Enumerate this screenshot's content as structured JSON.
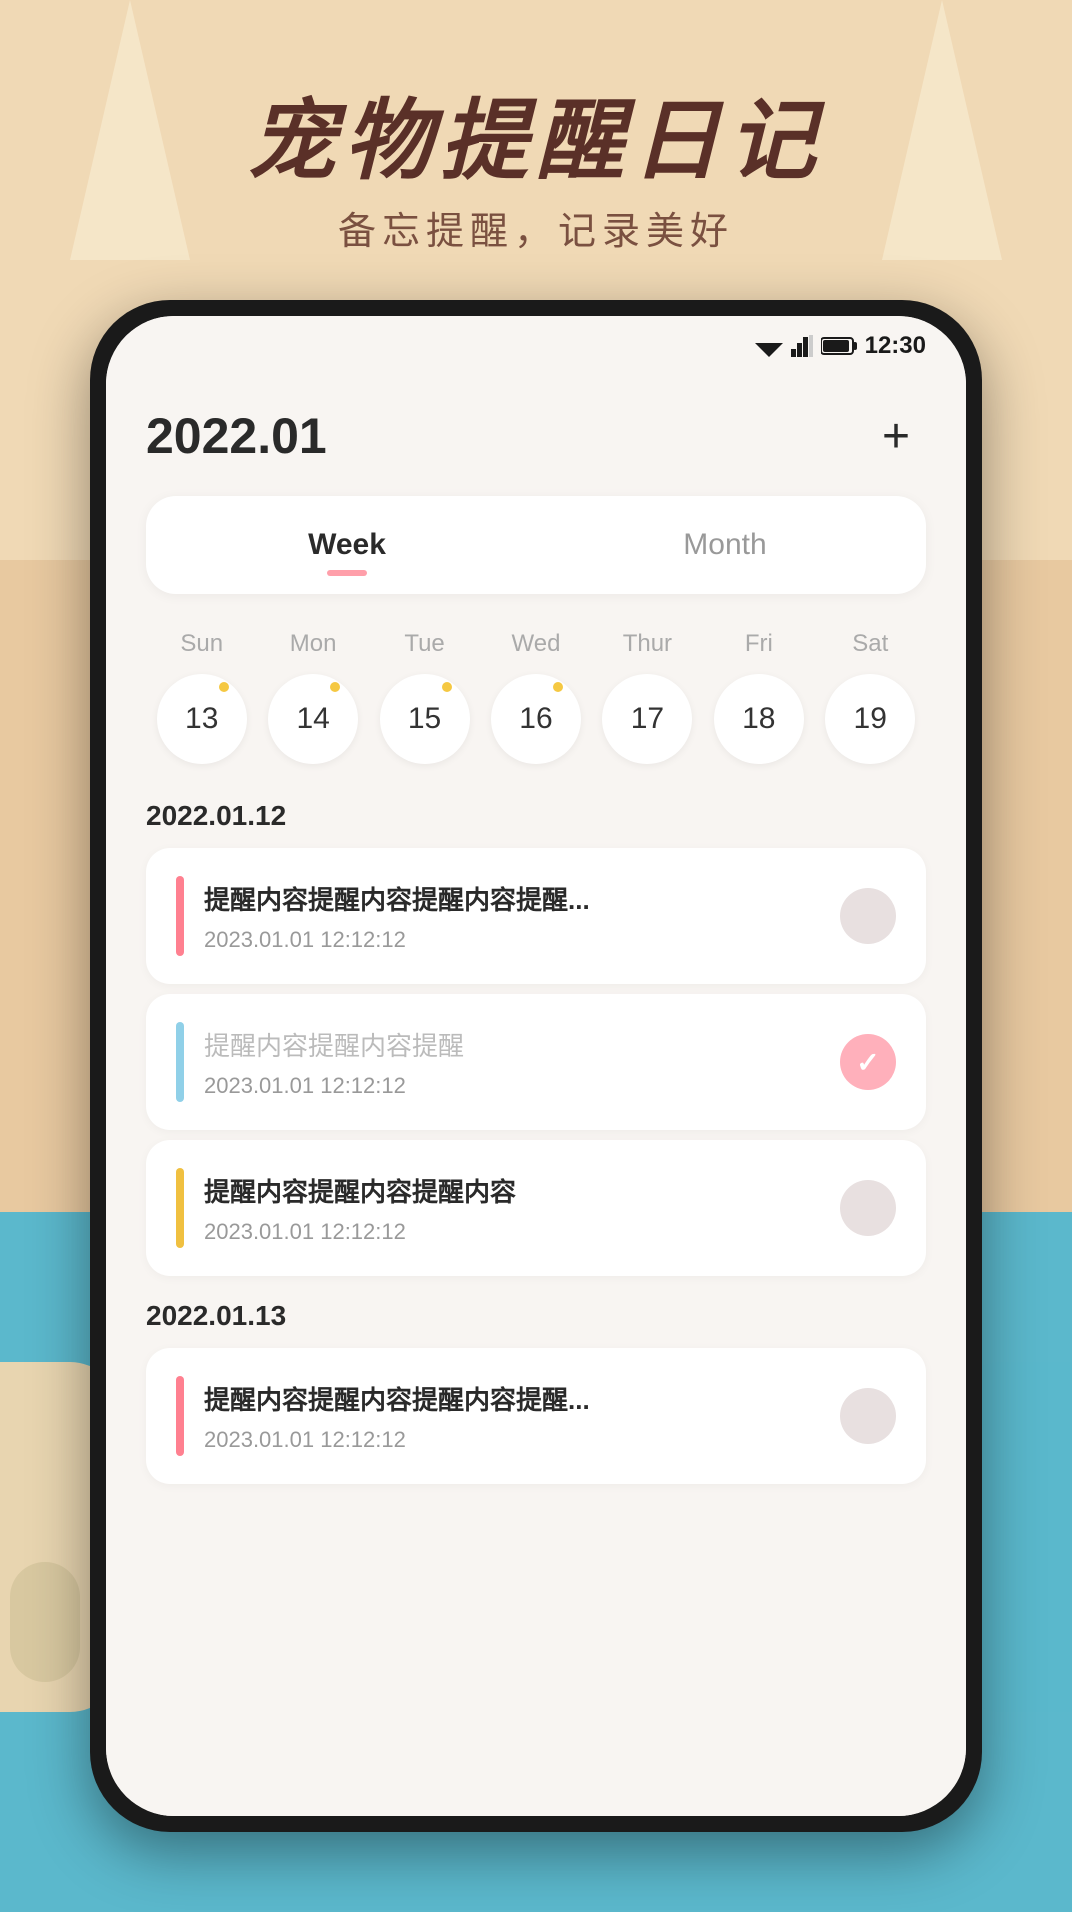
{
  "app": {
    "title": "宠物提醒日记",
    "subtitle": "备忘提醒，记录美好",
    "status_time": "12:30"
  },
  "header": {
    "date": "2022.01",
    "add_button": "+"
  },
  "tabs": [
    {
      "label": "Week",
      "active": true
    },
    {
      "label": "Month",
      "active": false
    }
  ],
  "days": [
    {
      "label": "Sun"
    },
    {
      "label": "Mon"
    },
    {
      "label": "Tue"
    },
    {
      "label": "Wed"
    },
    {
      "label": "Thur"
    },
    {
      "label": "Fri"
    },
    {
      "label": "Sat"
    }
  ],
  "dates": [
    {
      "num": "13",
      "dot_color": "#f5c842"
    },
    {
      "num": "14",
      "dot_color": "#f5c842"
    },
    {
      "num": "15",
      "dot_color": "#f5c842"
    },
    {
      "num": "16",
      "dot_color": "#f5c842"
    },
    {
      "num": "17",
      "dot_color": ""
    },
    {
      "num": "18",
      "dot_color": ""
    },
    {
      "num": "19",
      "dot_color": ""
    }
  ],
  "sections": [
    {
      "date_label": "2022.01.12",
      "reminders": [
        {
          "bar_color": "#ff8090",
          "title": "提醒内容提醒内容提醒内容提醒...",
          "time": "2023.01.01  12:12:12",
          "checked": false,
          "muted": false
        },
        {
          "bar_color": "#90d0e8",
          "title": "提醒内容提醒内容提醒",
          "time": "2023.01.01  12:12:12",
          "checked": true,
          "muted": true
        },
        {
          "bar_color": "#f0c040",
          "title": "提醒内容提醒内容提醒内容",
          "time": "2023.01.01  12:12:12",
          "checked": false,
          "muted": false
        }
      ]
    },
    {
      "date_label": "2022.01.13",
      "reminders": [
        {
          "bar_color": "#ff8090",
          "title": "提醒内容提醒内容提醒内容提醒...",
          "time": "2023.01.01  12:12:12",
          "checked": false,
          "muted": false
        }
      ]
    }
  ]
}
